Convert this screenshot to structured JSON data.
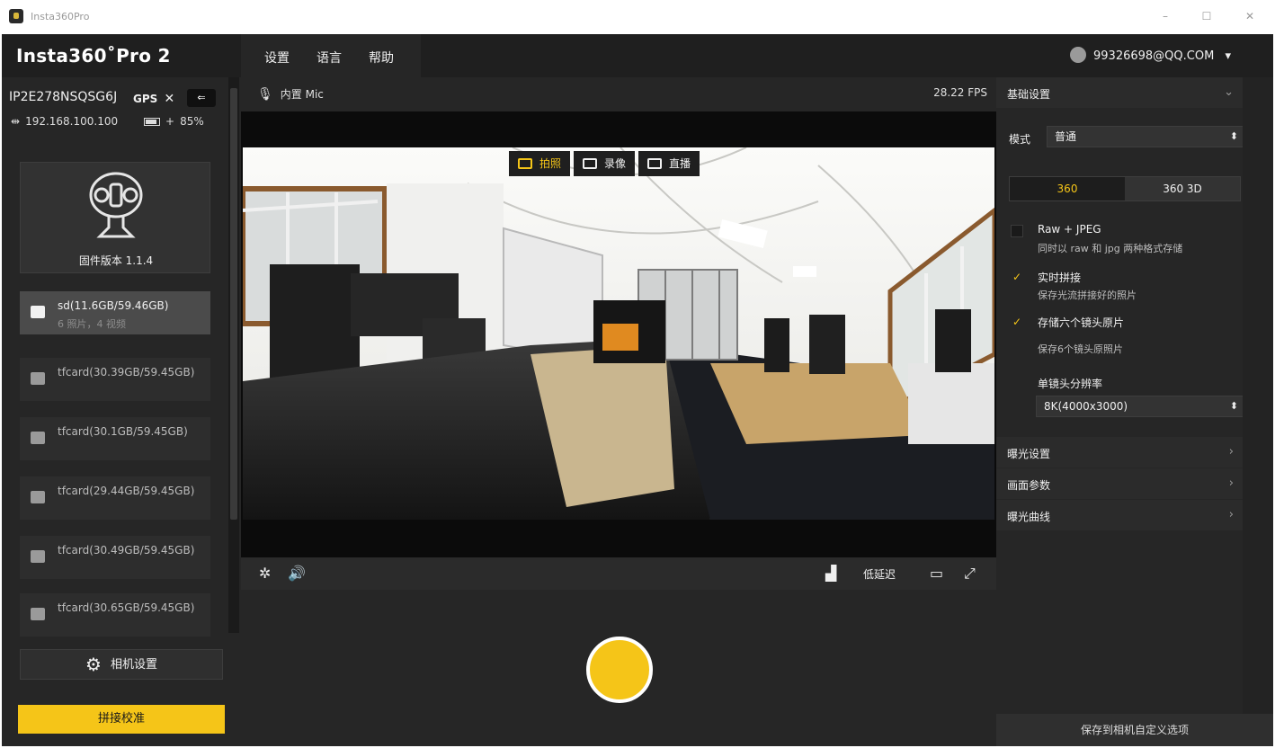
{
  "window": {
    "title": "Insta360Pro",
    "buttons": [
      "–",
      "☐",
      "✕"
    ]
  },
  "brand": "Insta360˚Pro 2",
  "menu": [
    "设置",
    "语言",
    "帮助"
  ],
  "user": {
    "account": "99326698@QQ.COM",
    "caret": "▾"
  },
  "device": {
    "id": "IP2E278NSQSG6J",
    "gps_label": "GPS",
    "gps_status": "✕",
    "ip": "192.168.100.100",
    "battery_percent": 85,
    "battery_text": "85%",
    "firmware": "固件版本 1.1.4"
  },
  "storage": [
    {
      "label": "sd(11.6GB/59.46GB)",
      "sub": "6 照片，4 视频",
      "selected": true
    },
    {
      "label": "tfcard(30.39GB/59.45GB)",
      "sub": "",
      "selected": false
    },
    {
      "label": "tfcard(30.1GB/59.45GB)",
      "sub": "",
      "selected": false
    },
    {
      "label": "tfcard(29.44GB/59.45GB)",
      "sub": "",
      "selected": false
    },
    {
      "label": "tfcard(30.49GB/59.45GB)",
      "sub": "",
      "selected": false
    },
    {
      "label": "tfcard(30.65GB/59.45GB)",
      "sub": "",
      "selected": false
    }
  ],
  "camera_settings_label": "相机设置",
  "stitch_calibration_label": "拼接校准",
  "preview": {
    "mic": "内置 Mic",
    "fps": "28.22 FPS",
    "modes": [
      {
        "label": "拍照",
        "active": true,
        "icon": "camera-icon"
      },
      {
        "label": "录像",
        "active": false,
        "icon": "video-icon"
      },
      {
        "label": "直播",
        "active": false,
        "icon": "live-icon"
      }
    ],
    "latency": "低延迟"
  },
  "right_panel": {
    "basic_settings": "基础设置",
    "mode_label": "模式",
    "mode_value": "普通",
    "segment": [
      "360",
      "360 3D"
    ],
    "raw_jpeg": {
      "label": "Raw + JPEG",
      "desc": "同时以 raw 和 jpg 两种格式存储",
      "checked": false
    },
    "realtime_stitch": {
      "label": "实时拼接",
      "desc": "保存光流拼接好的照片",
      "checked": true
    },
    "save_six": {
      "label": "存储六个镜头原片",
      "desc": "保存6个镜头原照片",
      "checked": true
    },
    "resolution_label": "单镜头分辨率",
    "resolution_value": "8K(4000x3000)",
    "sections": [
      "曝光设置",
      "画面参数",
      "曝光曲线"
    ],
    "save_button": "保存到相机自定义选项"
  },
  "colors": {
    "accent": "#f5c518",
    "panel": "#262626",
    "dark": "#1f1f1f"
  }
}
